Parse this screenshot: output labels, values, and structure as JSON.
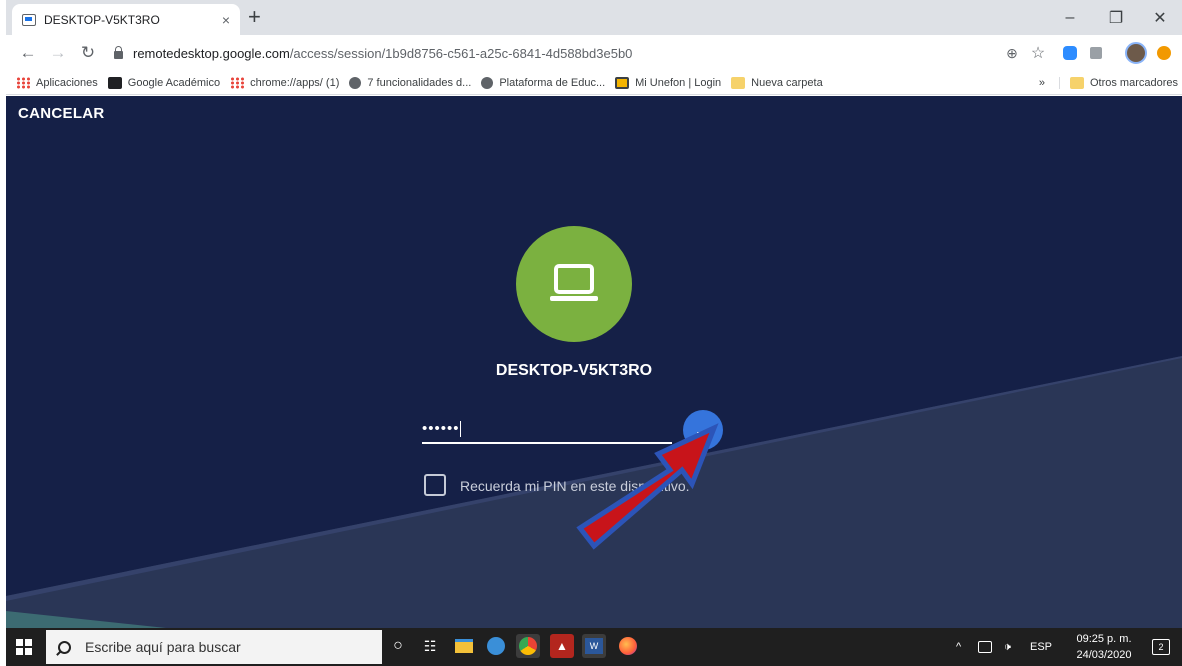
{
  "browser": {
    "tab_title": "DESKTOP-V5KT3RO",
    "tab_close": "×",
    "new_tab": "+",
    "url_domain": "remotedesktop.google.com",
    "url_path": "/access/session/1b9d8756-c561-a25c-6841-4d588bd3e5b0",
    "bookmarks": [
      "Aplicaciones",
      "Google Académico",
      "chrome://apps/ (1)",
      "7 funcionalidades d...",
      "Plataforma de Educ...",
      "Mi Unefon | Login",
      "Nueva carpeta"
    ],
    "bookmarks_overflow": "»",
    "other_bookmarks": "Otros marcadores"
  },
  "session": {
    "cancel_label": "CANCELAR",
    "host_name": "DESKTOP-V5KT3RO",
    "pin_value": "••••••",
    "remember_label": "Recuerda mi PIN en este dispositivo."
  },
  "taskbar": {
    "search_placeholder": "Escribe aquí para buscar",
    "language": "ESP",
    "time": "09:25 p. m.",
    "date": "24/03/2020",
    "notifications_count": "2"
  },
  "colors": {
    "page_bg": "#152047",
    "host_circle": "#7bb140",
    "go_button": "#3574dc",
    "arrow_red": "#c8141a",
    "arrow_border": "#2c54b8"
  }
}
